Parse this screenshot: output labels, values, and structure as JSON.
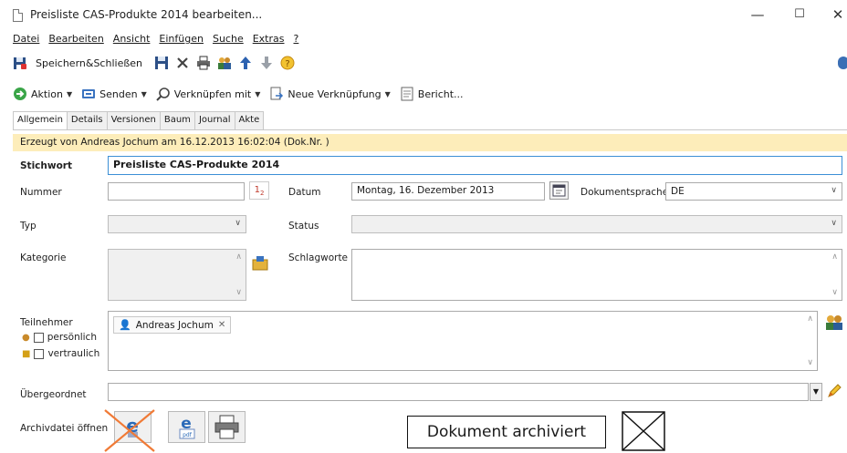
{
  "window": {
    "title": "Preisliste CAS-Produkte 2014 bearbeiten...",
    "minimize": "—",
    "maximize": "☐",
    "close": "✕"
  },
  "menu": [
    "Datei",
    "Bearbeiten",
    "Ansicht",
    "Einfügen",
    "Suche",
    "Extras",
    "?"
  ],
  "toolbar1": {
    "save_close_label": "Speichern&Schließen"
  },
  "toolbar2": {
    "action": "Aktion",
    "send": "Senden",
    "link_with": "Verknüpfen mit",
    "new_link": "Neue Verknüpfung",
    "report": "Bericht..."
  },
  "tabs": [
    "Allgemein",
    "Details",
    "Versionen",
    "Baum",
    "Journal",
    "Akte"
  ],
  "info_bar": "Erzeugt von Andreas Jochum am 16.12.2013 16:02:04 (Dok.Nr. )",
  "form": {
    "keyword_label": "Stichwort",
    "keyword_value": "Preisliste CAS-Produkte 2014",
    "number_label": "Nummer",
    "number_value": "",
    "date_label": "Datum",
    "date_value": "Montag, 16. Dezember 2013",
    "doclang_label": "Dokumentsprache",
    "doclang_value": "DE",
    "type_label": "Typ",
    "status_label": "Status",
    "category_label": "Kategorie",
    "tags_label": "Schlagworte",
    "participants_label": "Teilnehmer",
    "participant_name": "Andreas Jochum",
    "personal_label": "persönlich",
    "confidential_label": "vertraulich",
    "parent_label": "Übergeordnet",
    "archive_open_label": "Archivdatei öffnen"
  },
  "archive_status": "Dokument archiviert",
  "colors": {
    "info_bar_bg": "#fdedba",
    "focus_border": "#3c8fd6"
  }
}
